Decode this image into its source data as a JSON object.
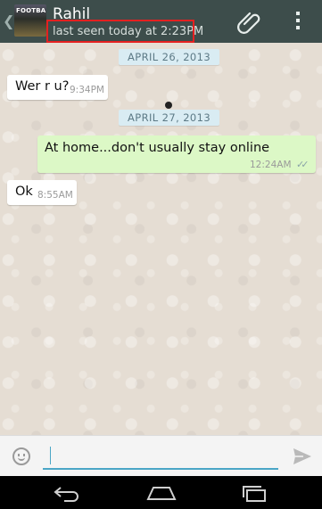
{
  "header": {
    "contact_name": "Rahil",
    "last_seen": "last seen today at 2:23PM",
    "avatar_text": "FOOTBALL"
  },
  "chat": {
    "dates": [
      "APRIL 26, 2013",
      "APRIL 27, 2013"
    ],
    "messages": [
      {
        "direction": "in",
        "text": "Wer r u?",
        "time": "9:34PM"
      },
      {
        "direction": "out",
        "text": "At home...don't usually stay online",
        "time": "12:24AM",
        "ticks": "✓✓"
      },
      {
        "direction": "in",
        "text": "Ok",
        "time": "8:55AM"
      }
    ]
  },
  "composer": {
    "value": "",
    "placeholder": ""
  },
  "colors": {
    "header_bg": "#3d4d4b",
    "chat_bg": "#e5ddd3",
    "outgoing_bubble": "#dcf8c6",
    "incoming_bubble": "#ffffff",
    "date_chip": "#d9ecf3",
    "highlight_box": "#e52020",
    "input_underline": "#4aa6c6"
  },
  "icons": {
    "back": "chevron-left-icon",
    "attach": "paperclip-icon",
    "menu": "overflow-menu-icon",
    "emoji": "smiley-icon",
    "send": "send-icon",
    "nav_back": "back-arrow-icon",
    "nav_home": "home-icon",
    "nav_recents": "recents-icon"
  }
}
